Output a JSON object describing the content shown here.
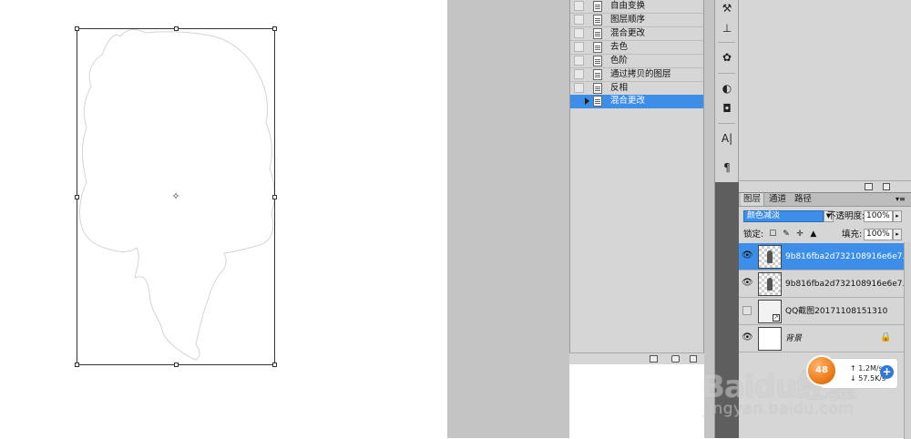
{
  "history_panel": {
    "items": [
      {
        "label": "自由变换",
        "selected": false
      },
      {
        "label": "图层顺序",
        "selected": false
      },
      {
        "label": "混合更改",
        "selected": false
      },
      {
        "label": "去色",
        "selected": false
      },
      {
        "label": "色阶",
        "selected": false
      },
      {
        "label": "通过拷贝的图层",
        "selected": false
      },
      {
        "label": "反相",
        "selected": false
      },
      {
        "label": "混合更改",
        "selected": true
      }
    ]
  },
  "layers_panel": {
    "tabs": [
      {
        "label": "图层",
        "active": true
      },
      {
        "label": "通道",
        "active": false
      },
      {
        "label": "路径",
        "active": false
      }
    ],
    "blend_mode": "颜色减淡",
    "opacity_label": "不透明度:",
    "opacity_value": "100%",
    "lock_label": "锁定:",
    "fill_label": "填充:",
    "fill_value": "100%",
    "layers": [
      {
        "name": "9b816fba2d732108916e6e7...",
        "visible": true,
        "selected": true
      },
      {
        "name": "9b816fba2d732108916e6e7...",
        "visible": true,
        "selected": false
      },
      {
        "name": "QQ截图20171108151310",
        "visible": false,
        "selected": false
      },
      {
        "name": "背景",
        "visible": true,
        "selected": false,
        "locked": true
      }
    ]
  },
  "net_widget": {
    "up_speed": "1.2M/s",
    "down_speed": "57.5K/s",
    "ball_label": "48"
  },
  "watermark": {
    "logo": "Baidu经验",
    "url": "jingyan.baidu.com"
  },
  "colors": {
    "selection_blue": "#3d8ee8",
    "panel_grey": "#d6d6d6",
    "workspace_grey": "#c4c4c4"
  }
}
